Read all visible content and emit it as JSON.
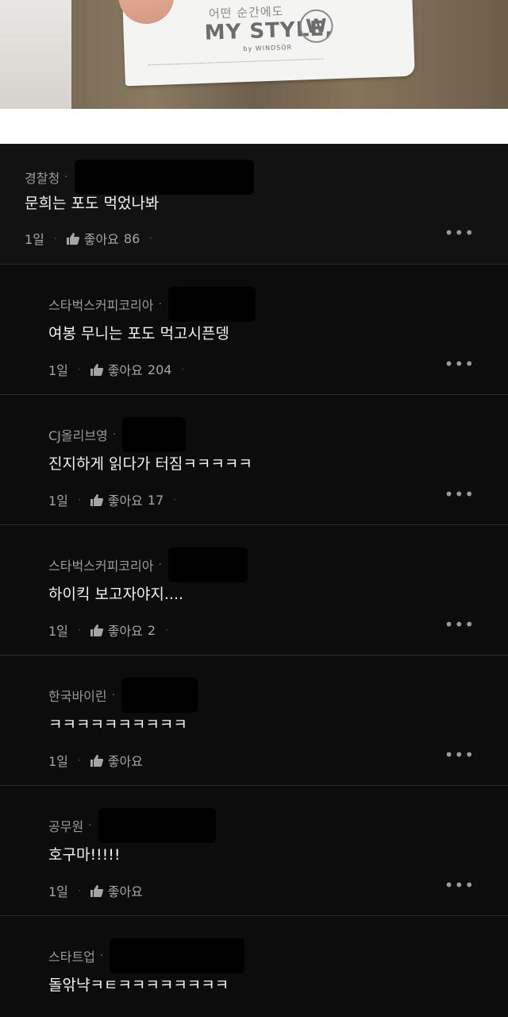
{
  "photo": {
    "tagline": "어떤 순간에도",
    "brand": "MY STYLE,",
    "sub": "by WINDSOR",
    "seal": "W"
  },
  "icons": {
    "like": "thumbs-up-icon",
    "more": "more-dots-icon"
  },
  "comments": [
    {
      "author": "경찰청",
      "text": "문희는 포도 먹었나봐",
      "time": "1일",
      "like_label": "좋아요",
      "like_count": "86",
      "kind": "top"
    },
    {
      "author": "스타벅스커피코리아",
      "text": "여봉 무니는 포도 먹고시픈뎅",
      "time": "1일",
      "like_label": "좋아요",
      "like_count": "204",
      "kind": "reply"
    },
    {
      "author": "CJ올리브영",
      "text": "진지하게 읽다가 터짐ㅋㅋㅋㅋㅋ",
      "time": "1일",
      "like_label": "좋아요",
      "like_count": "17",
      "kind": "reply"
    },
    {
      "author": "스타벅스커피코리아",
      "text": "하이킥 보고자야지....",
      "time": "1일",
      "like_label": "좋아요",
      "like_count": "2",
      "kind": "reply"
    },
    {
      "author": "한국바이린",
      "text": "ㅋㅋㅋㅋㅋㅋㅋㅋㅋㅋ",
      "time": "1일",
      "like_label": "좋아요",
      "like_count": "",
      "kind": "reply"
    },
    {
      "author": "공무원",
      "text": "호구마!!!!!",
      "time": "1일",
      "like_label": "좋아요",
      "like_count": "",
      "kind": "reply"
    },
    {
      "author": "스타트업",
      "text": "돌앆냑ㅋㅌㅋㅋㅋㅋㅋㅋㅋㅋ",
      "time": "",
      "like_label": "",
      "like_count": "",
      "kind": "reply"
    }
  ]
}
